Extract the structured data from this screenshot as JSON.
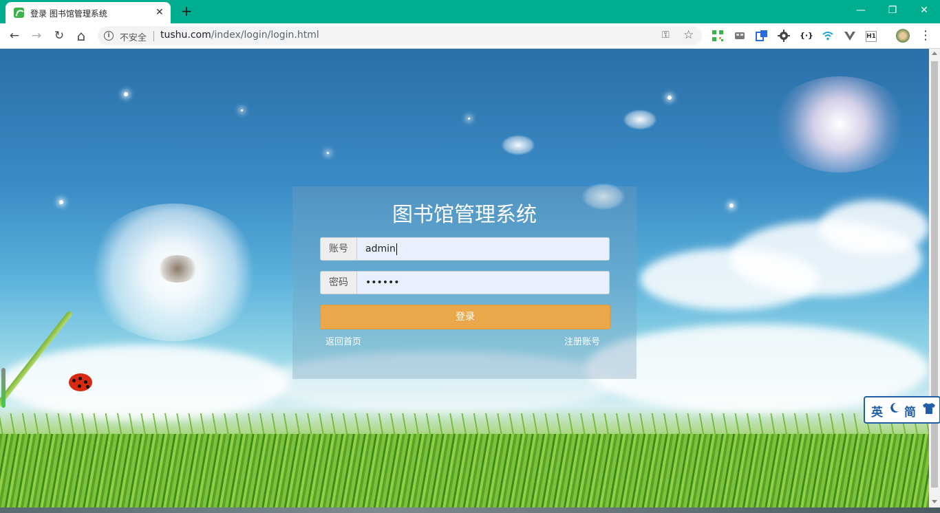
{
  "browser": {
    "tab_title": "登录 图书馆管理系统",
    "tab_close": "✕",
    "new_tab": "+",
    "minimize": "—",
    "restore": "❐",
    "close": "✕",
    "back": "←",
    "forward": "→",
    "reload": "↻",
    "home": "⌂",
    "security_label": "不安全",
    "url_host": "tushu.com",
    "url_path": "/index/login/login.html",
    "key_icon": "⚿",
    "star_icon": "☆",
    "menu_icon": "⋮",
    "extensions": [
      "qr-code-icon",
      "tab-manager-icon",
      "translate-icon",
      "gear-icon",
      "json-icon",
      "wifi-icon",
      "vue-icon",
      "h1-icon",
      "avatar-icon"
    ]
  },
  "login": {
    "title": "图书馆管理系统",
    "username_label": "账号",
    "username_value": "admin",
    "password_label": "密码",
    "password_value": "••••••",
    "submit_label": "登录",
    "back_home_label": "返回首页",
    "register_label": "注册账号"
  },
  "ime": {
    "lang": "英",
    "mode_icon": "moon-icon",
    "script": "简",
    "skin_icon": "shirt-icon"
  },
  "colors": {
    "tabstrip": "#00ad8e",
    "login_button": "#eaa84b",
    "ime_accent": "#1f5ea8"
  }
}
